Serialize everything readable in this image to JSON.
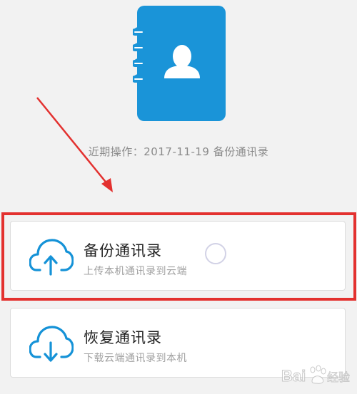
{
  "header": {
    "icon": "contacts-book-icon",
    "recent_operation": "近期操作：2017-11-19 备份通讯录"
  },
  "options": [
    {
      "icon": "cloud-upload-icon",
      "title": "备份通讯录",
      "subtitle": "上传本机通讯录到云端"
    },
    {
      "icon": "cloud-download-icon",
      "title": "恢复通讯录",
      "subtitle": "下载云端通讯录到本机"
    }
  ],
  "colors": {
    "accent_blue": "#1592d7",
    "highlight_red": "#e3312f"
  },
  "watermark": {
    "text": "Bai",
    "text2": "经验"
  }
}
